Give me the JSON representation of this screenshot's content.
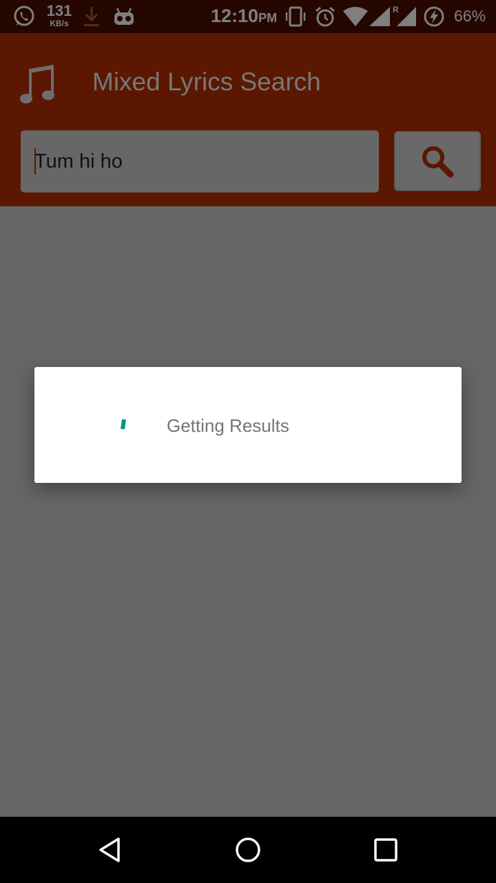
{
  "status_bar": {
    "net_speed_value": "131",
    "net_speed_unit": "KB/s",
    "time": "12:10",
    "time_suffix": "PM",
    "battery_percent": "66%",
    "icons": [
      "whatsapp-icon",
      "download-icon",
      "cyanogen-icon",
      "vibrate-icon",
      "alarm-icon",
      "wifi-icon",
      "signal-icon",
      "roaming-signal-icon",
      "battery-charging-icon"
    ]
  },
  "header": {
    "title": "Mixed Lyrics Search",
    "logo_icon": "music-note-icon"
  },
  "search": {
    "value": "Tum hi ho",
    "button_icon": "search-icon"
  },
  "dialog": {
    "message": "Getting Results"
  },
  "nav": {
    "back_icon": "back-icon",
    "home_icon": "home-icon",
    "recents_icon": "recents-icon"
  },
  "colors": {
    "primary": "#b62e00",
    "status_bar": "#4a0f00",
    "spinner": "#009688"
  }
}
